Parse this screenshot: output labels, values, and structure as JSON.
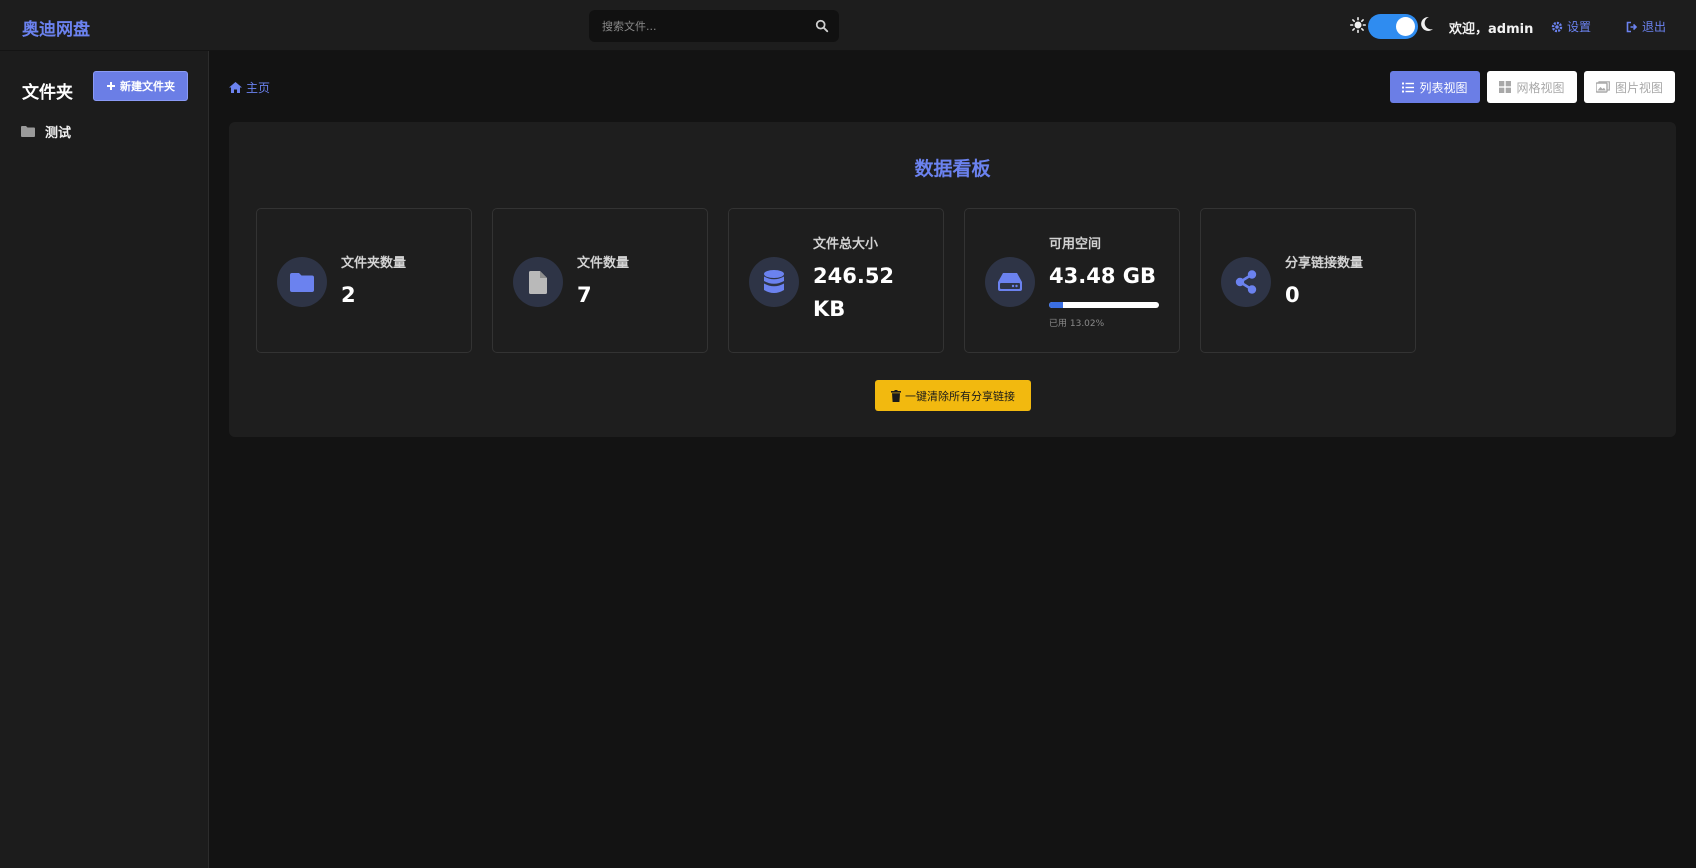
{
  "header": {
    "brand": "奥迪网盘",
    "search_placeholder": "搜索文件...",
    "welcome": "欢迎，admin",
    "settings_label": "设置",
    "logout_label": "退出",
    "theme_toggle": "dark"
  },
  "sidebar": {
    "title": "文件夹",
    "new_folder_label": "新建文件夹",
    "folders": [
      {
        "name": "测试",
        "icon": "folder-icon"
      }
    ]
  },
  "breadcrumb": {
    "home_label": "主页"
  },
  "views": {
    "list_label": "列表视图",
    "grid_label": "网格视图",
    "image_label": "图片视图",
    "active": "list"
  },
  "dashboard": {
    "title": "数据看板",
    "cards": [
      {
        "label": "文件夹数量",
        "value": "2",
        "icon": "folder-icon"
      },
      {
        "label": "文件数量",
        "value": "7",
        "icon": "file-icon"
      },
      {
        "label": "文件总大小",
        "value_line1": "246.52",
        "value_line2": "KB",
        "icon": "database-icon"
      },
      {
        "label": "可用空间",
        "value": "43.48 GB",
        "used_text": "已用 13.02%",
        "used_percent": 13.02,
        "icon": "hdd-icon"
      },
      {
        "label": "分享链接数量",
        "value": "0",
        "icon": "share-icon"
      }
    ],
    "clear_label": "一键清除所有分享链接"
  },
  "colors": {
    "accent": "#6b82ef",
    "warning": "#f2b90f",
    "toggle": "#2f8cf0",
    "background": "#131313"
  }
}
